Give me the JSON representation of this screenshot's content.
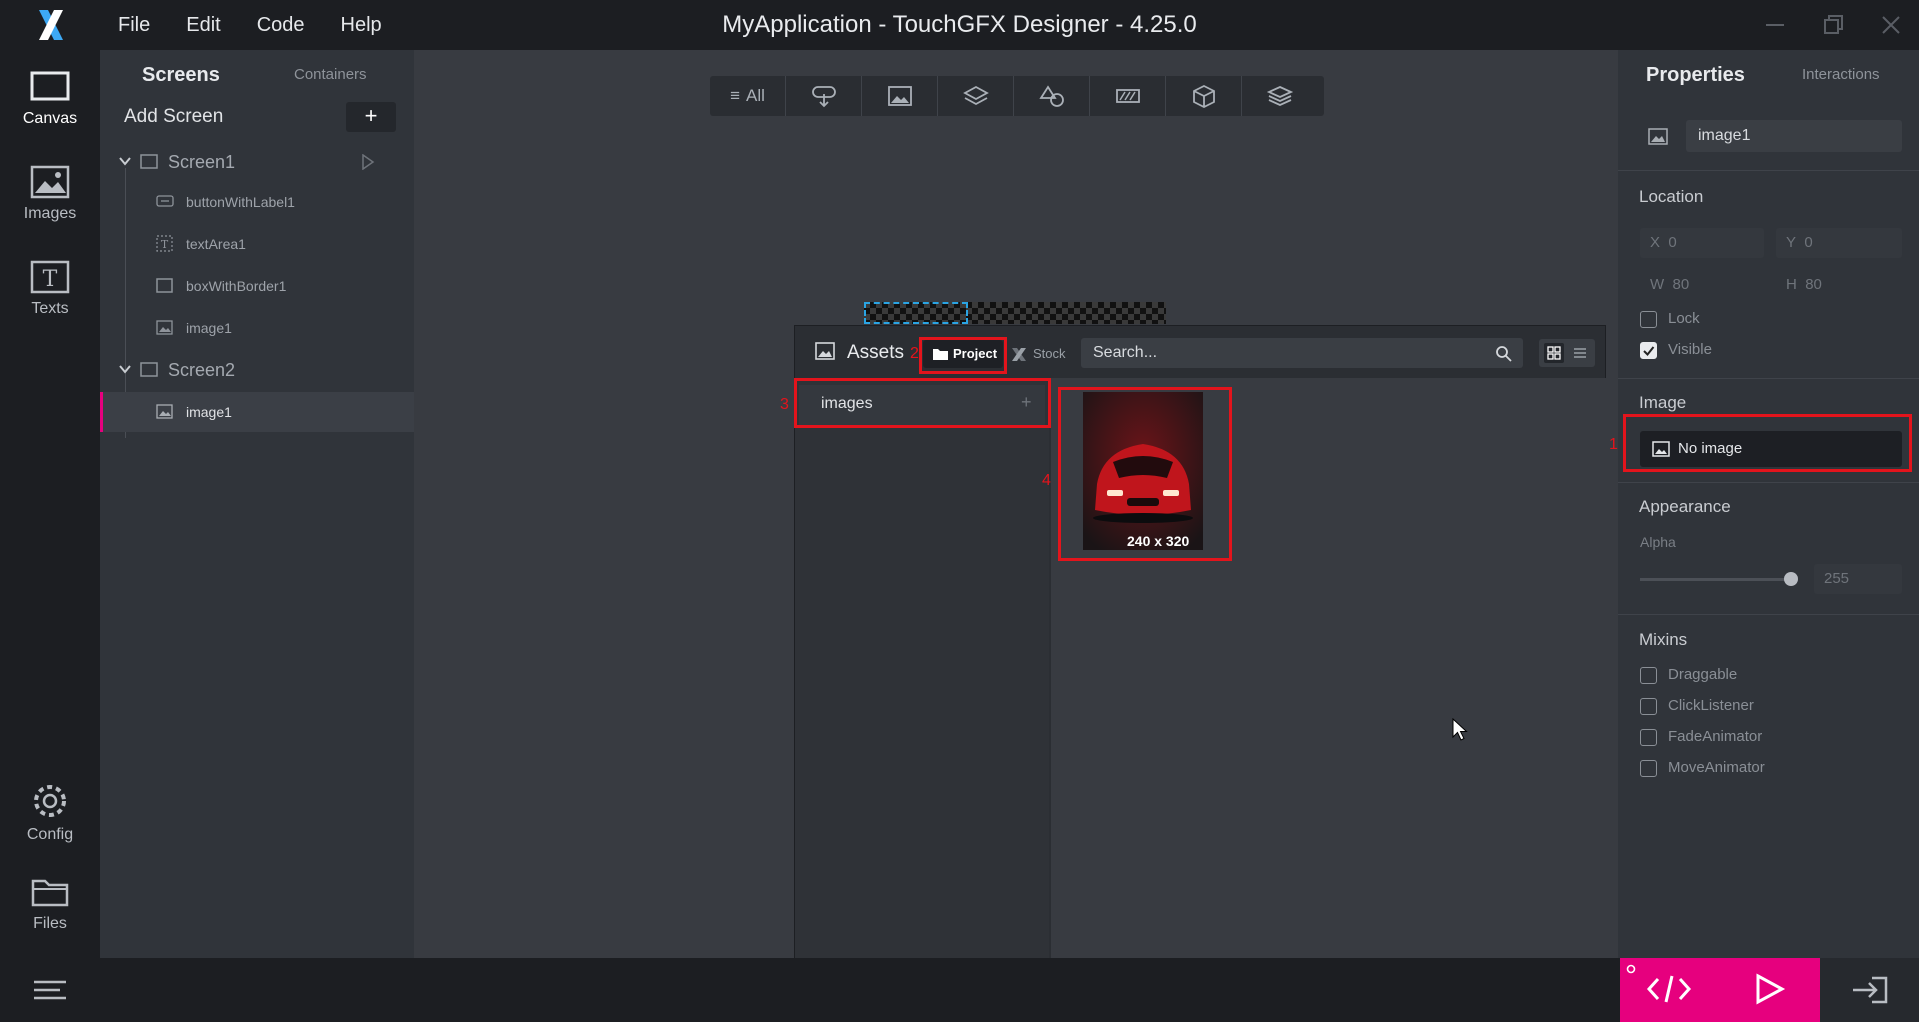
{
  "app": {
    "title": "MyApplication - TouchGFX Designer - 4.25.0",
    "menu": [
      "File",
      "Edit",
      "Code",
      "Help"
    ]
  },
  "rail": {
    "canvas": "Canvas",
    "images": "Images",
    "texts": "Texts",
    "config": "Config",
    "files": "Files"
  },
  "tree": {
    "tab_screens": "Screens",
    "tab_containers": "Containers",
    "add_screen": "Add Screen",
    "add_symbol": "+",
    "screen1": "Screen1",
    "screen1_children": [
      "buttonWithLabel1",
      "textArea1",
      "boxWithBorder1",
      "image1"
    ],
    "screen2": "Screen2",
    "screen2_children": [
      "image1"
    ]
  },
  "filterbar": {
    "all_label": "All",
    "icons": [
      "interaction-icon",
      "image-icon",
      "layers-icon",
      "shapes-icon",
      "progress-icon",
      "3d-box-icon",
      "stack-icon"
    ]
  },
  "assets": {
    "title": "Assets",
    "tab_project": "Project",
    "tab_stock": "Stock",
    "search_placeholder": "Search...",
    "folder": "images",
    "folder_add": "+",
    "thumb_size": "240 x 320"
  },
  "properties": {
    "tab_properties": "Properties",
    "tab_interactions": "Interactions",
    "name": "image1",
    "location": "Location",
    "x_label": "X",
    "x_value": "0",
    "y_label": "Y",
    "y_value": "0",
    "w_label": "W",
    "w_value": "80",
    "h_label": "H",
    "h_value": "80",
    "lock": "Lock",
    "visible": "Visible",
    "image_section": "Image",
    "no_image": "No image",
    "appearance": "Appearance",
    "alpha_label": "Alpha",
    "alpha_value": "255",
    "alpha_fraction": 1.0,
    "mixins": "Mixins",
    "mixin_items": [
      "Draggable",
      "ClickListener",
      "FadeAnimator",
      "MoveAnimator"
    ],
    "visible_checked": true,
    "lock_checked": false
  },
  "annotations": [
    "1",
    "2",
    "3",
    "4"
  ],
  "colors": {
    "accent": "#e6007e",
    "selection": "#2aa4e3",
    "annotation": "#e3141c"
  }
}
